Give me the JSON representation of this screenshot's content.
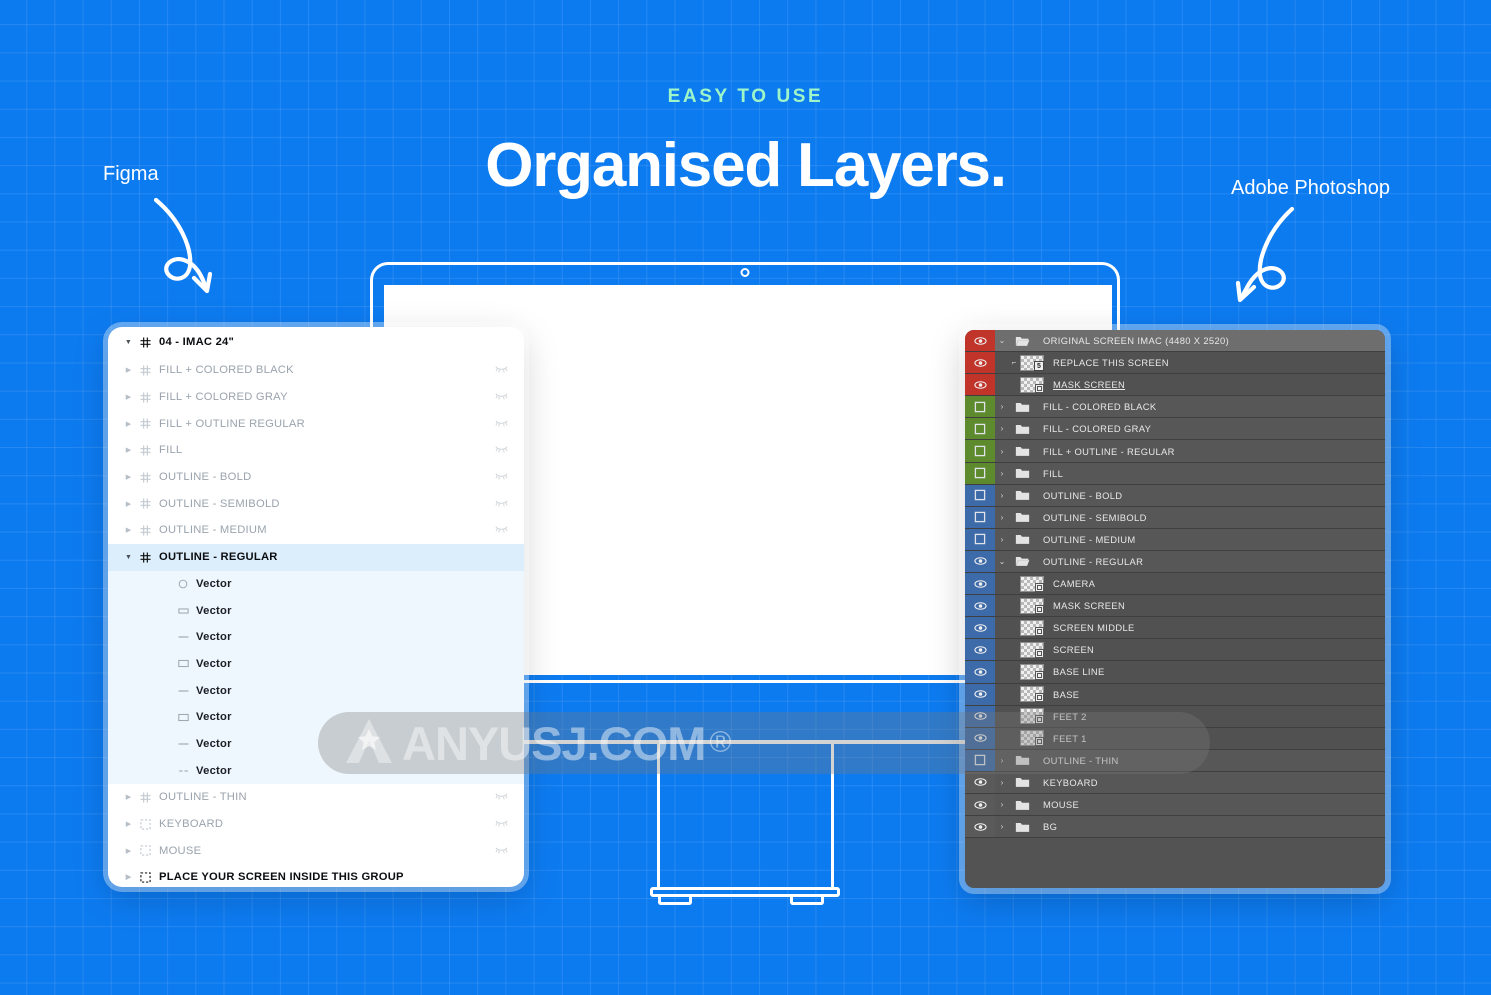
{
  "colors": {
    "background": "#0d7bf0",
    "eyebrow": "#9df5c8",
    "headline": "#ffffff",
    "figma_panel_bg": "#ffffff",
    "figma_selected": "#dceefb",
    "ps_panel_bg": "#535353",
    "ps_red": "#c0342a",
    "ps_green": "#5d8a2c",
    "ps_blue": "#3d6aa8"
  },
  "header": {
    "eyebrow": "EASY TO USE",
    "headline": "Organised Layers."
  },
  "annotations": {
    "left": {
      "label": "Figma",
      "icon": "curved-arrow-loop-icon"
    },
    "right": {
      "label": "Adobe Photoshop",
      "icon": "curved-arrow-loop-icon"
    }
  },
  "mockup": {
    "device": "imac-24",
    "camera_icon": "camera-dot-icon"
  },
  "figma_panel": {
    "root": {
      "label": "04 - IMAC 24\"",
      "icon": "component-icon",
      "caret": "down",
      "expanded": true
    },
    "rows": [
      {
        "label": "FILL + COLORED BLACK",
        "icon": "component-icon",
        "caret": "right",
        "state": "hidden",
        "eye": "eye-closed-icon"
      },
      {
        "label": "FILL + COLORED GRAY",
        "icon": "component-icon",
        "caret": "right",
        "state": "hidden",
        "eye": "eye-closed-icon"
      },
      {
        "label": "FILL + OUTLINE REGULAR",
        "icon": "component-icon",
        "caret": "right",
        "state": "hidden",
        "eye": "eye-closed-icon"
      },
      {
        "label": "FILL",
        "icon": "component-icon",
        "caret": "right",
        "state": "hidden",
        "eye": "eye-closed-icon"
      },
      {
        "label": "OUTLINE - BOLD",
        "icon": "component-icon",
        "caret": "right",
        "state": "hidden",
        "eye": "eye-closed-icon"
      },
      {
        "label": "OUTLINE - SEMIBOLD",
        "icon": "component-icon",
        "caret": "right",
        "state": "hidden",
        "eye": "eye-closed-icon"
      },
      {
        "label": "OUTLINE - MEDIUM",
        "icon": "component-icon",
        "caret": "right",
        "state": "hidden",
        "eye": "eye-closed-icon"
      },
      {
        "label": "OUTLINE - REGULAR",
        "icon": "component-icon",
        "caret": "down",
        "state": "selected",
        "eye": ""
      }
    ],
    "children": [
      {
        "label": "Vector",
        "icon": "ellipse-icon"
      },
      {
        "label": "Vector",
        "icon": "rect-small-icon"
      },
      {
        "label": "Vector",
        "icon": "line-icon"
      },
      {
        "label": "Vector",
        "icon": "rect-icon"
      },
      {
        "label": "Vector",
        "icon": "line-icon"
      },
      {
        "label": "Vector",
        "icon": "rect-icon"
      },
      {
        "label": "Vector",
        "icon": "line-icon"
      },
      {
        "label": "Vector",
        "icon": "dash-icon"
      }
    ],
    "footer_rows": [
      {
        "label": "OUTLINE - THIN",
        "icon": "component-icon",
        "caret": "right",
        "state": "hidden",
        "eye": "eye-closed-icon"
      },
      {
        "label": "KEYBOARD",
        "icon": "group-icon",
        "caret": "right",
        "state": "hidden",
        "eye": "eye-closed-icon"
      },
      {
        "label": "MOUSE",
        "icon": "group-icon",
        "caret": "right",
        "state": "hidden",
        "eye": "eye-closed-icon"
      },
      {
        "label": "PLACE YOUR SCREEN INSIDE THIS GROUP",
        "icon": "group-icon",
        "caret": "right",
        "state": "strong",
        "eye": ""
      }
    ]
  },
  "photoshop_panel": {
    "rows": [
      {
        "label": "ORIGINAL SCREEN IMAC (4480 X 2520)",
        "type": "group",
        "level": 0,
        "caret": "down",
        "vis": "red",
        "eye": "eye-icon",
        "thumb": "folder-open-icon",
        "style": "hdr",
        "underline": false,
        "clip": false
      },
      {
        "label": "REPLACE THIS SCREEN",
        "type": "layer",
        "level": 1,
        "caret": "",
        "vis": "red",
        "eye": "eye-icon",
        "thumb": "smart-object-thumb",
        "style": "lvl1",
        "underline": false,
        "clip": true
      },
      {
        "label": "MASK SCREEN",
        "type": "layer",
        "level": 1,
        "caret": "",
        "vis": "red",
        "eye": "eye-icon",
        "thumb": "smart-object-thumb",
        "style": "lvl1",
        "underline": true,
        "clip": false
      },
      {
        "label": "FILL - COLORED BLACK",
        "type": "group",
        "level": 0,
        "caret": "right",
        "vis": "green",
        "eye": "eye-off-icon",
        "thumb": "folder-icon",
        "style": "lvl0",
        "underline": false,
        "clip": false
      },
      {
        "label": "FILL - COLORED GRAY",
        "type": "group",
        "level": 0,
        "caret": "right",
        "vis": "green",
        "eye": "eye-off-icon",
        "thumb": "folder-icon",
        "style": "lvl0",
        "underline": false,
        "clip": false
      },
      {
        "label": "FILL + OUTLINE - REGULAR",
        "type": "group",
        "level": 0,
        "caret": "right",
        "vis": "green",
        "eye": "eye-off-icon",
        "thumb": "folder-icon",
        "style": "lvl0",
        "underline": false,
        "clip": false
      },
      {
        "label": "FILL",
        "type": "group",
        "level": 0,
        "caret": "right",
        "vis": "green",
        "eye": "eye-off-icon",
        "thumb": "folder-icon",
        "style": "lvl0",
        "underline": false,
        "clip": false
      },
      {
        "label": "OUTLINE - BOLD",
        "type": "group",
        "level": 0,
        "caret": "right",
        "vis": "blue",
        "eye": "eye-off-icon",
        "thumb": "folder-icon",
        "style": "lvl0",
        "underline": false,
        "clip": false
      },
      {
        "label": "OUTLINE - SEMIBOLD",
        "type": "group",
        "level": 0,
        "caret": "right",
        "vis": "blue",
        "eye": "eye-off-icon",
        "thumb": "folder-icon",
        "style": "lvl0",
        "underline": false,
        "clip": false
      },
      {
        "label": "OUTLINE - MEDIUM",
        "type": "group",
        "level": 0,
        "caret": "right",
        "vis": "blue",
        "eye": "eye-off-icon",
        "thumb": "folder-icon",
        "style": "lvl0",
        "underline": false,
        "clip": false
      },
      {
        "label": "OUTLINE - REGULAR",
        "type": "group",
        "level": 0,
        "caret": "down",
        "vis": "blue",
        "eye": "eye-icon",
        "thumb": "folder-open-icon",
        "style": "lvl0",
        "underline": false,
        "clip": false
      },
      {
        "label": "CAMERA",
        "type": "layer",
        "level": 1,
        "caret": "",
        "vis": "blue",
        "eye": "eye-icon",
        "thumb": "smart-object-thumb",
        "style": "lvl1",
        "underline": false,
        "clip": false
      },
      {
        "label": "MASK SCREEN",
        "type": "layer",
        "level": 1,
        "caret": "",
        "vis": "blue",
        "eye": "eye-icon",
        "thumb": "smart-object-thumb",
        "style": "lvl1",
        "underline": false,
        "clip": false
      },
      {
        "label": "SCREEN MIDDLE",
        "type": "layer",
        "level": 1,
        "caret": "",
        "vis": "blue",
        "eye": "eye-icon",
        "thumb": "smart-object-thumb",
        "style": "lvl1",
        "underline": false,
        "clip": false
      },
      {
        "label": "SCREEN",
        "type": "layer",
        "level": 1,
        "caret": "",
        "vis": "blue",
        "eye": "eye-icon",
        "thumb": "smart-object-thumb",
        "style": "lvl1",
        "underline": false,
        "clip": false
      },
      {
        "label": "BASE LINE",
        "type": "layer",
        "level": 1,
        "caret": "",
        "vis": "blue",
        "eye": "eye-icon",
        "thumb": "smart-object-thumb",
        "style": "lvl1",
        "underline": false,
        "clip": false
      },
      {
        "label": "BASE",
        "type": "layer",
        "level": 1,
        "caret": "",
        "vis": "blue",
        "eye": "eye-icon",
        "thumb": "smart-object-thumb",
        "style": "lvl1",
        "underline": false,
        "clip": false
      },
      {
        "label": "FEET 2",
        "type": "layer",
        "level": 1,
        "caret": "",
        "vis": "blue",
        "eye": "eye-icon",
        "thumb": "smart-object-thumb",
        "style": "lvl1",
        "underline": false,
        "clip": false
      },
      {
        "label": "FEET 1",
        "type": "layer",
        "level": 1,
        "caret": "",
        "vis": "blue",
        "eye": "eye-icon",
        "thumb": "smart-object-thumb",
        "style": "lvl1",
        "underline": false,
        "clip": false
      },
      {
        "label": "OUTLINE - THIN",
        "type": "group",
        "level": 0,
        "caret": "right",
        "vis": "blue",
        "eye": "eye-off-icon",
        "thumb": "folder-icon",
        "style": "lvl0",
        "underline": false,
        "clip": false
      },
      {
        "label": "KEYBOARD",
        "type": "group",
        "level": 0,
        "caret": "right",
        "vis": "gray",
        "eye": "eye-icon",
        "thumb": "folder-icon",
        "style": "lvl0",
        "underline": false,
        "clip": false
      },
      {
        "label": "MOUSE",
        "type": "group",
        "level": 0,
        "caret": "right",
        "vis": "gray",
        "eye": "eye-icon",
        "thumb": "folder-icon",
        "style": "lvl0",
        "underline": false,
        "clip": false
      },
      {
        "label": "BG",
        "type": "group",
        "level": 0,
        "caret": "right",
        "vis": "gray",
        "eye": "eye-icon",
        "thumb": "folder-icon",
        "style": "lvl0",
        "underline": false,
        "clip": false
      }
    ]
  },
  "watermark": {
    "text": "ANYUSJ.COM",
    "registered": "®",
    "logo_icon": "a-star-logo-icon"
  }
}
